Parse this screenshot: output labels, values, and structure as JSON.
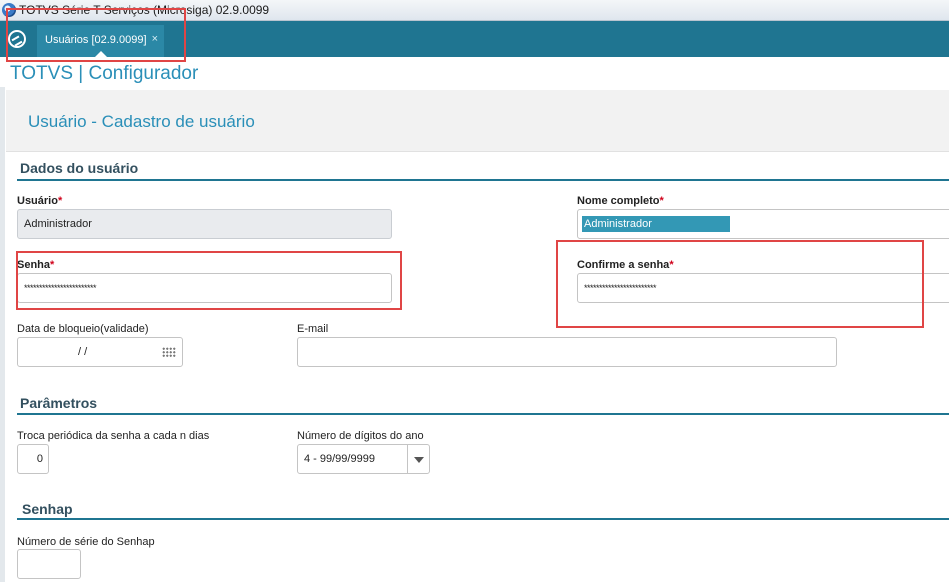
{
  "window": {
    "title": "TOTVS Série T Serviços (Microsiga) 02.9.0099"
  },
  "tabs": [
    {
      "label": "Usuários [02.9.0099]",
      "close": "×"
    }
  ],
  "app": {
    "title": "TOTVS | Configurador"
  },
  "page": {
    "title": "Usuário - Cadastro de usuário"
  },
  "sections": {
    "user_data": "Dados do usuário",
    "parameters": "Parâmetros",
    "senhap": "Senhap"
  },
  "fields": {
    "usuario": {
      "label": "Usuário",
      "required": "*",
      "value": "Administrador"
    },
    "nome_completo": {
      "label": "Nome completo",
      "required": "*",
      "value": "Administrador"
    },
    "senha": {
      "label": "Senha",
      "required": "*",
      "value": "************************"
    },
    "confirme_senha": {
      "label": "Confirme a senha",
      "required": "*",
      "value": "************************"
    },
    "data_bloqueio": {
      "label": "Data de bloqueio(validade)",
      "value": "/ /"
    },
    "email": {
      "label": "E-mail",
      "value": ""
    },
    "troca_periodica": {
      "label": "Troca periódica da senha a cada n dias",
      "value": "0"
    },
    "digitos_ano": {
      "label": "Número de dígitos do ano",
      "value": "4 - 99/99/9999"
    },
    "serie_senhap": {
      "label": "Número de série do Senhap",
      "value": ""
    }
  },
  "colors": {
    "tabbar": "#1f7591",
    "accent": "#2a8fb8",
    "highlight": "#e04545",
    "required": "#d0021b"
  }
}
